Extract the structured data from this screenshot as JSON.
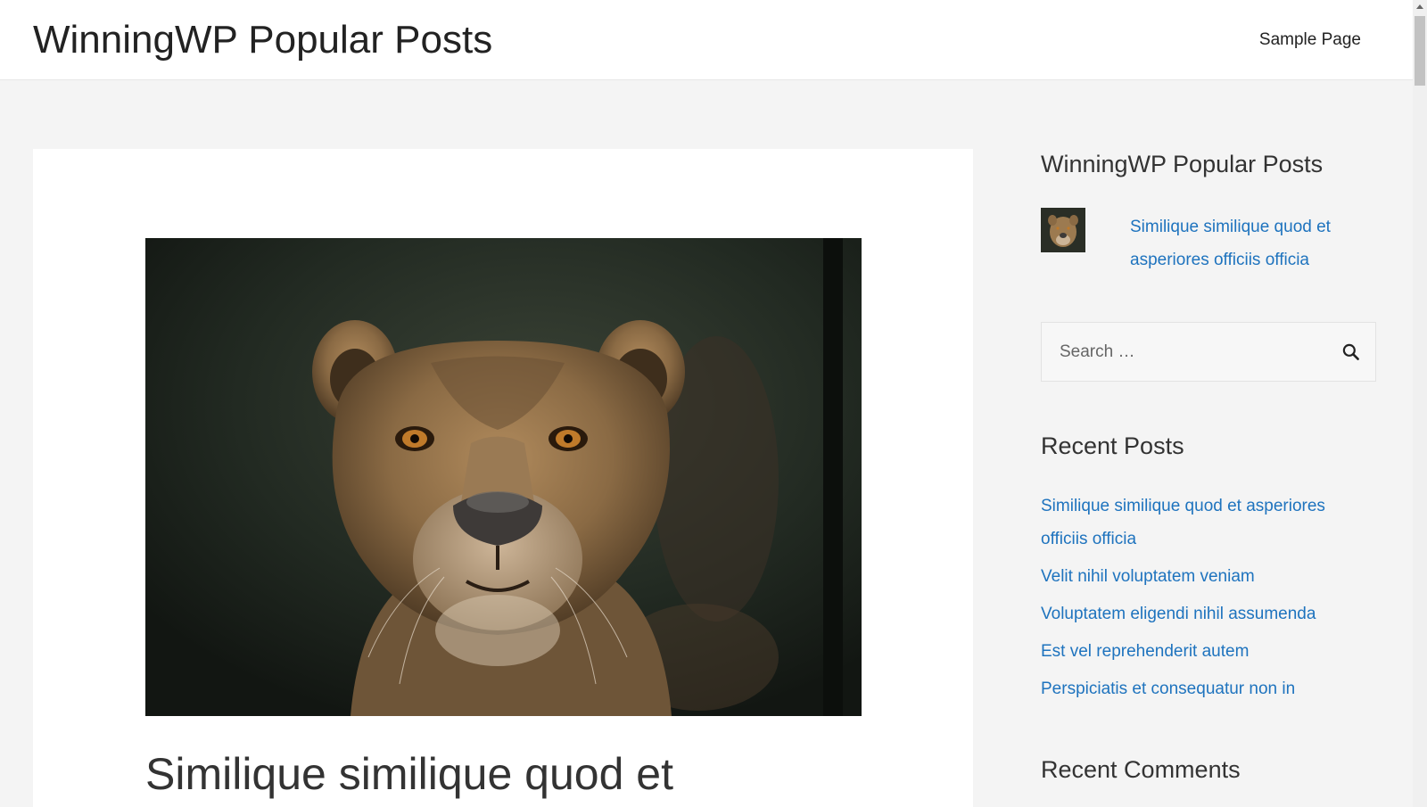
{
  "header": {
    "site_title": "WinningWP Popular Posts",
    "nav": [
      {
        "label": "Sample Page"
      }
    ]
  },
  "article": {
    "image_alt": "lioness",
    "title": "Similique similique quod et"
  },
  "sidebar": {
    "popular": {
      "title": "WinningWP Popular Posts",
      "posts": [
        {
          "title": "Similique similique quod et asperiores officiis officia"
        }
      ]
    },
    "search": {
      "placeholder": "Search …",
      "icon": "search-icon"
    },
    "recent_posts": {
      "title": "Recent Posts",
      "items": [
        {
          "label": "Similique similique quod et asperiores officiis officia"
        },
        {
          "label": "Velit nihil voluptatem veniam"
        },
        {
          "label": "Voluptatem eligendi nihil assumenda"
        },
        {
          "label": "Est vel reprehenderit autem"
        },
        {
          "label": "Perspiciatis et consequatur non in"
        }
      ]
    },
    "recent_comments": {
      "title": "Recent Comments"
    }
  },
  "colors": {
    "link": "#1e73be",
    "text": "#333333",
    "background": "#f4f4f4"
  }
}
